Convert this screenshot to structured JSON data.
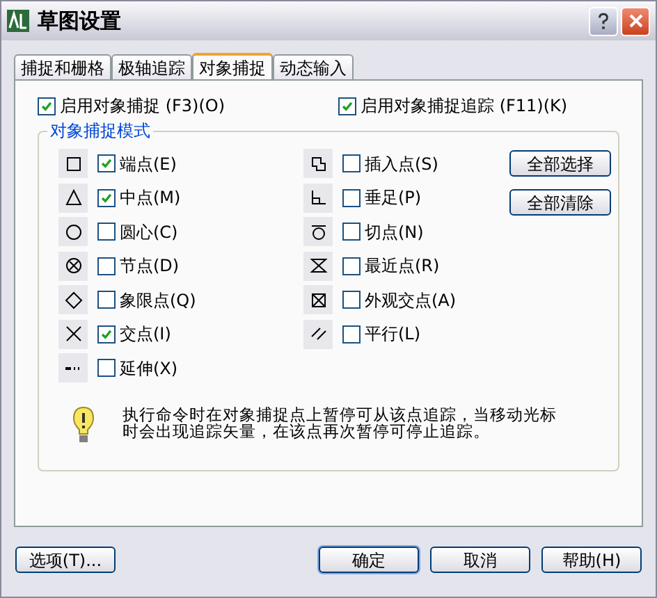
{
  "window": {
    "title": "草图设置"
  },
  "tabs": [
    {
      "label": "捕捉和栅格",
      "selected": false
    },
    {
      "label": "极轴追踪",
      "selected": false
    },
    {
      "label": "对象捕捉",
      "selected": true
    },
    {
      "label": "动态输入",
      "selected": false
    }
  ],
  "enable_snap": {
    "label": "启用对象捕捉 (F3)(O)",
    "checked": true
  },
  "enable_tracking": {
    "label": "启用对象捕捉追踪 (F11)(K)",
    "checked": true
  },
  "group": {
    "title": "对象捕捉模式"
  },
  "modes_left": [
    {
      "label": "端点(E)",
      "checked": true
    },
    {
      "label": "中点(M)",
      "checked": true
    },
    {
      "label": "圆心(C)",
      "checked": false
    },
    {
      "label": "节点(D)",
      "checked": false
    },
    {
      "label": "象限点(Q)",
      "checked": false
    },
    {
      "label": "交点(I)",
      "checked": true
    },
    {
      "label": "延伸(X)",
      "checked": false
    }
  ],
  "modes_right": [
    {
      "label": "插入点(S)",
      "checked": false
    },
    {
      "label": "垂足(P)",
      "checked": false
    },
    {
      "label": "切点(N)",
      "checked": false
    },
    {
      "label": "最近点(R)",
      "checked": false
    },
    {
      "label": "外观交点(A)",
      "checked": false
    },
    {
      "label": "平行(L)",
      "checked": false
    }
  ],
  "side_buttons": [
    "全部选择",
    "全部清除"
  ],
  "tip": "执行命令时在对象捕捉点上暂停可从该点追踪，当移动光标时会出现追踪矢量，在该点再次暂停可停止追踪。",
  "footer": {
    "options": "选项(T)...",
    "buttons": [
      "确定",
      "取消",
      "帮助(H)"
    ]
  }
}
